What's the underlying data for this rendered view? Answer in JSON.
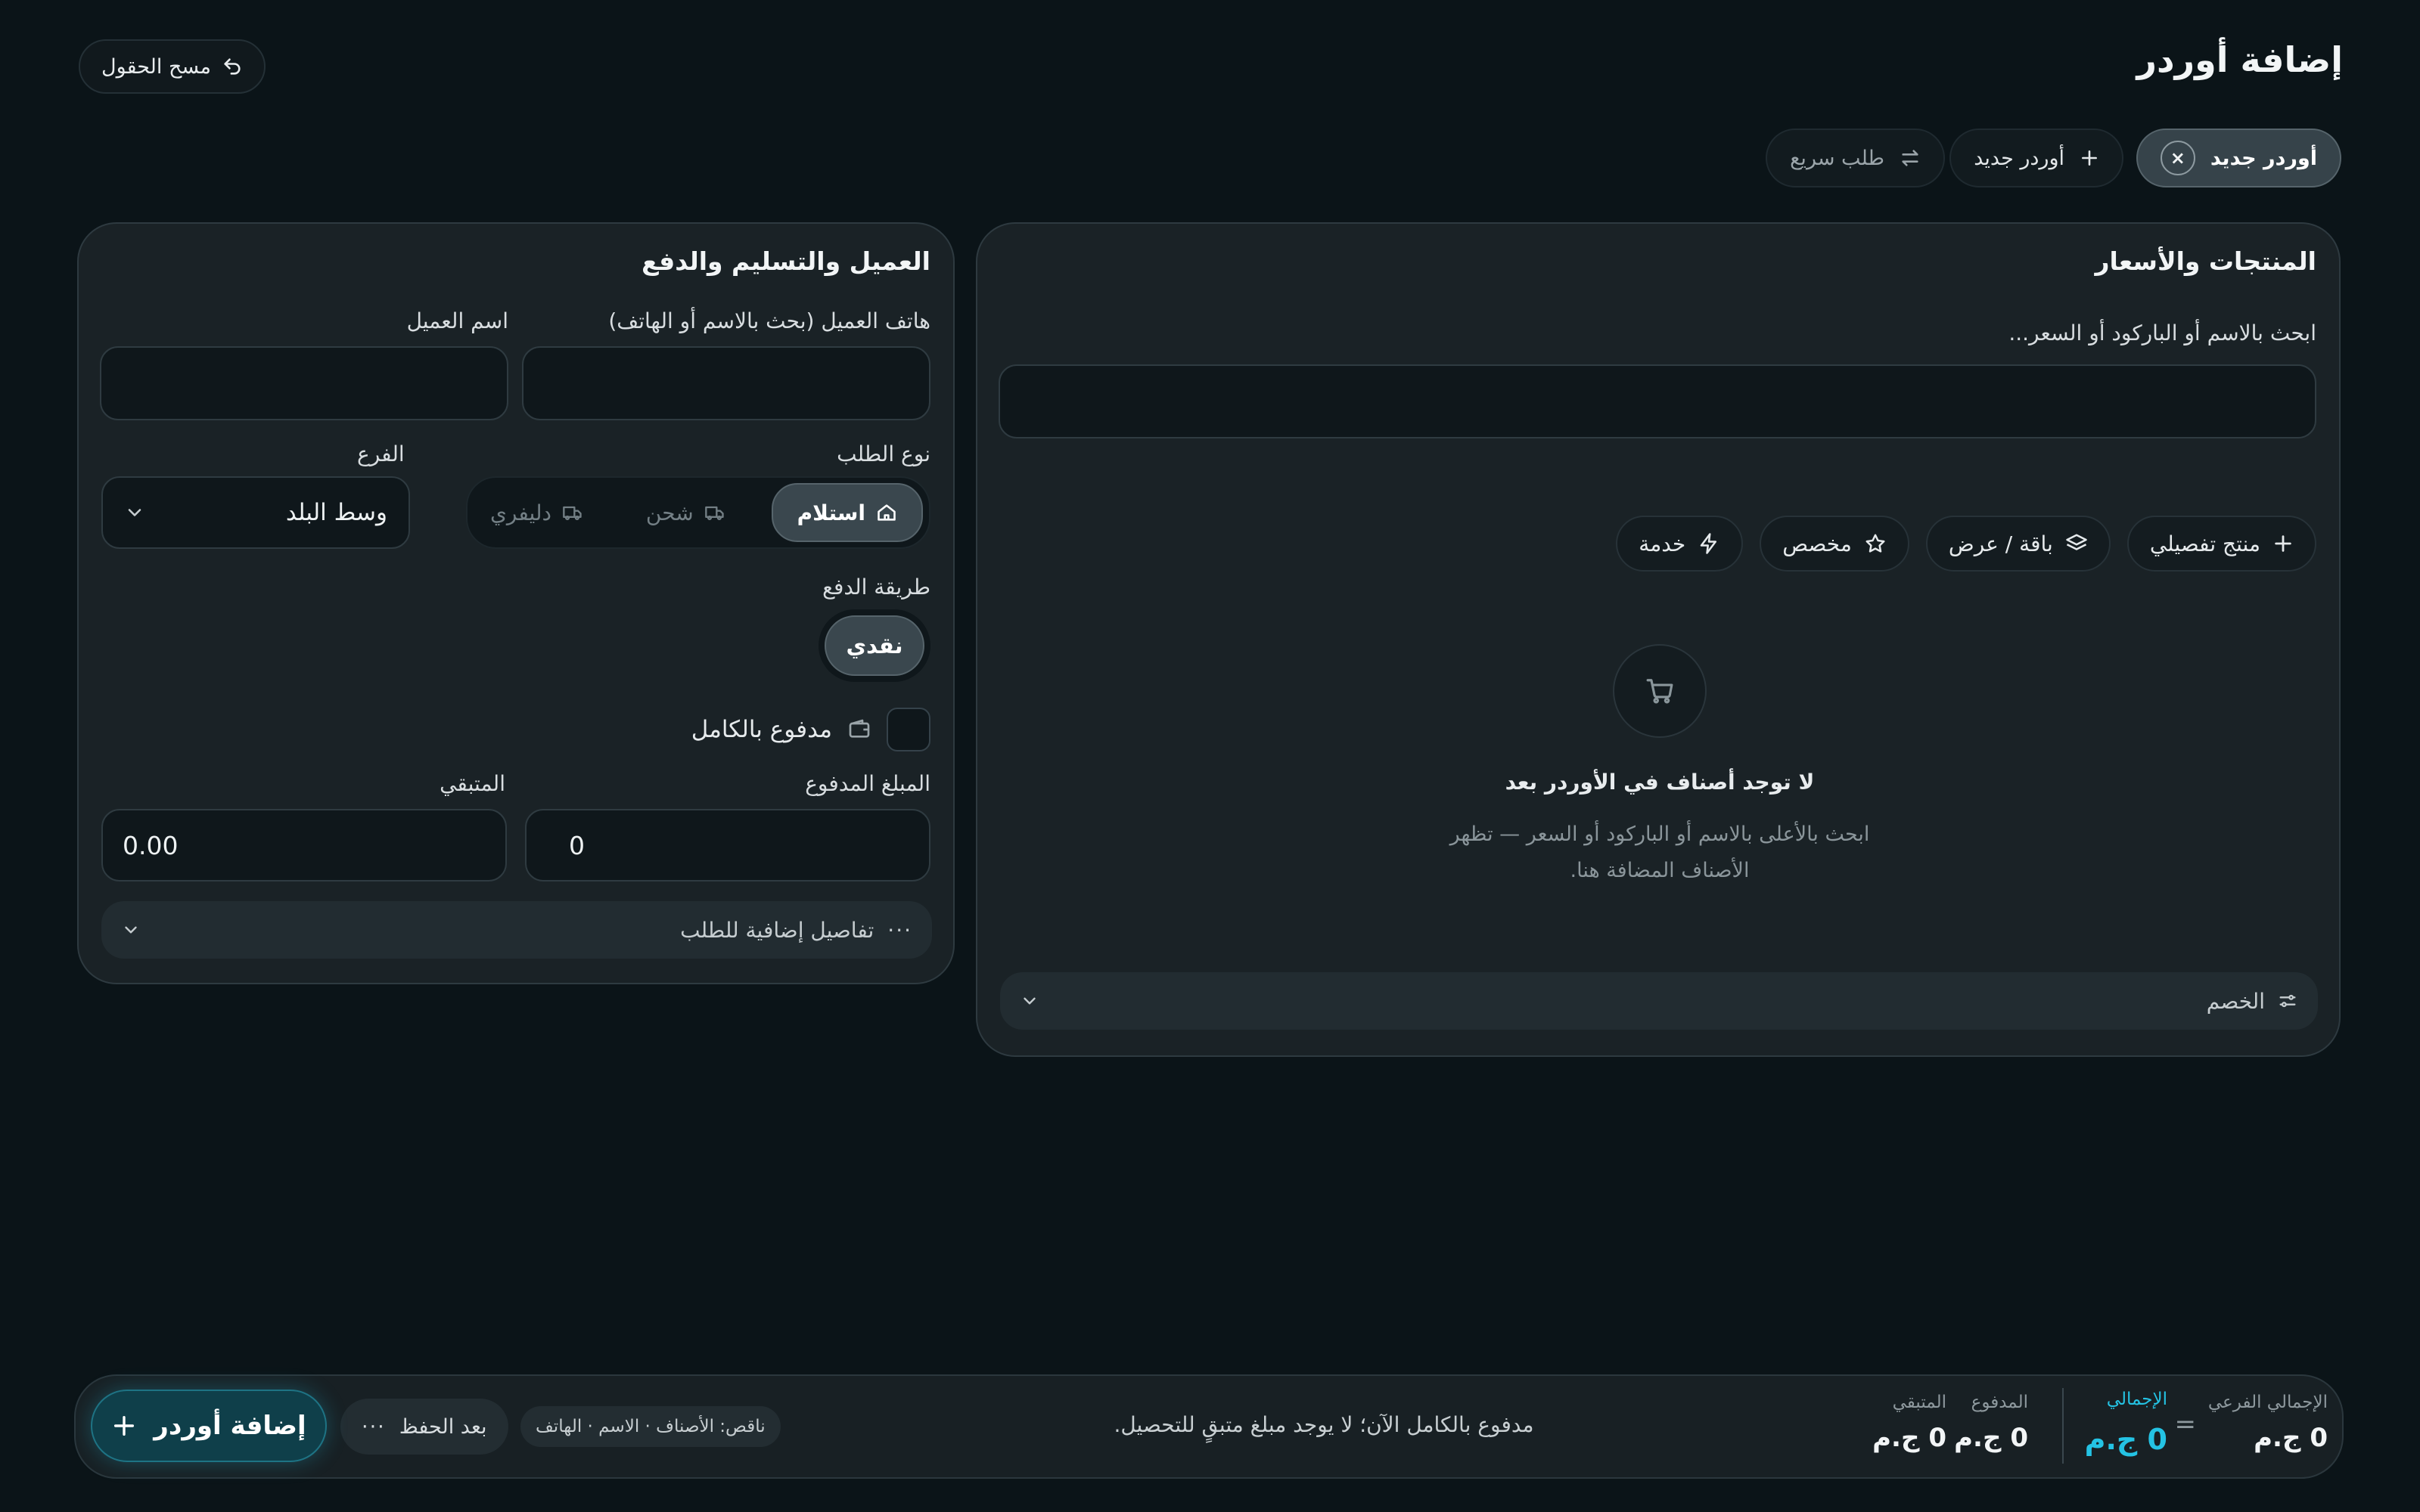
{
  "header": {
    "title": "إضافة أوردر",
    "clear_label": "مسح الحقول"
  },
  "tabs": [
    {
      "label": "أوردر جديد",
      "active": true,
      "icon": "close-icon"
    },
    {
      "label": "أوردر جديد",
      "icon": "plus-icon"
    },
    {
      "label": "طلب سريع",
      "icon": "swap-icon"
    }
  ],
  "products": {
    "title": "المنتجات والأسعار",
    "search_label": "ابحث بالاسم أو الباركود أو السعر...",
    "search_value": "",
    "quick_buttons": [
      {
        "label": "منتج تفصيلي",
        "icon": "plus-icon"
      },
      {
        "label": "باقة / عرض",
        "icon": "layers-icon"
      },
      {
        "label": "مخصص",
        "icon": "star-icon"
      },
      {
        "label": "خدمة",
        "icon": "bolt-icon"
      }
    ],
    "empty_title": "لا توجد أصناف في الأوردر بعد",
    "empty_line1": "ابحث بالأعلى بالاسم أو الباركود أو السعر — تظهر",
    "empty_line2": "الأصناف المضافة هنا.",
    "discount_label": "الخصم"
  },
  "customer": {
    "title": "العميل والتسليم والدفع",
    "phone_label": "هاتف العميل (بحث بالاسم أو الهاتف)",
    "phone_value": "",
    "name_label": "اسم العميل",
    "name_value": "",
    "order_type_label": "نوع الطلب",
    "order_types": [
      {
        "label": "استلام",
        "icon": "home-icon",
        "active": true
      },
      {
        "label": "شحن",
        "icon": "truck-icon",
        "active": false
      },
      {
        "label": "دليفري",
        "icon": "truck-icon",
        "active": false
      }
    ],
    "branch_label": "الفرع",
    "branch_value": "وسط البلد",
    "payment_label": "طريقة الدفع",
    "payment_value": "نقدي",
    "paid_full_label": "مدفوع بالكامل",
    "paid_full_checked": false,
    "paid_amount_label": "المبلغ المدفوع",
    "paid_amount_value": "0",
    "remaining_label": "المتبقي",
    "remaining_value": "0.00",
    "extra_details_label": "تفاصيل إضافية للطلب"
  },
  "summary": {
    "subtotal_label": "الإجمالي الفرعي",
    "subtotal_value": "0 ج.م",
    "equals": "=",
    "total_label": "الإجمالي",
    "total_value": "0 ج.م",
    "paid_label": "المدفوع",
    "paid_value": "0 ج.م",
    "remaining_label": "المتبقي",
    "remaining_value": "0 ج.م",
    "status_message": "مدفوع بالكامل الآن؛ لا يوجد مبلغ متبقٍ للتحصيل.",
    "missing_label": "ناقص: الأصناف · الاسم · الهاتف",
    "after_save_label": "بعد الحفظ",
    "add_order_label": "إضافة أوردر"
  },
  "colors": {
    "background": "#0b1418",
    "panel": "#1a2226",
    "accent": "#24c3e4"
  }
}
